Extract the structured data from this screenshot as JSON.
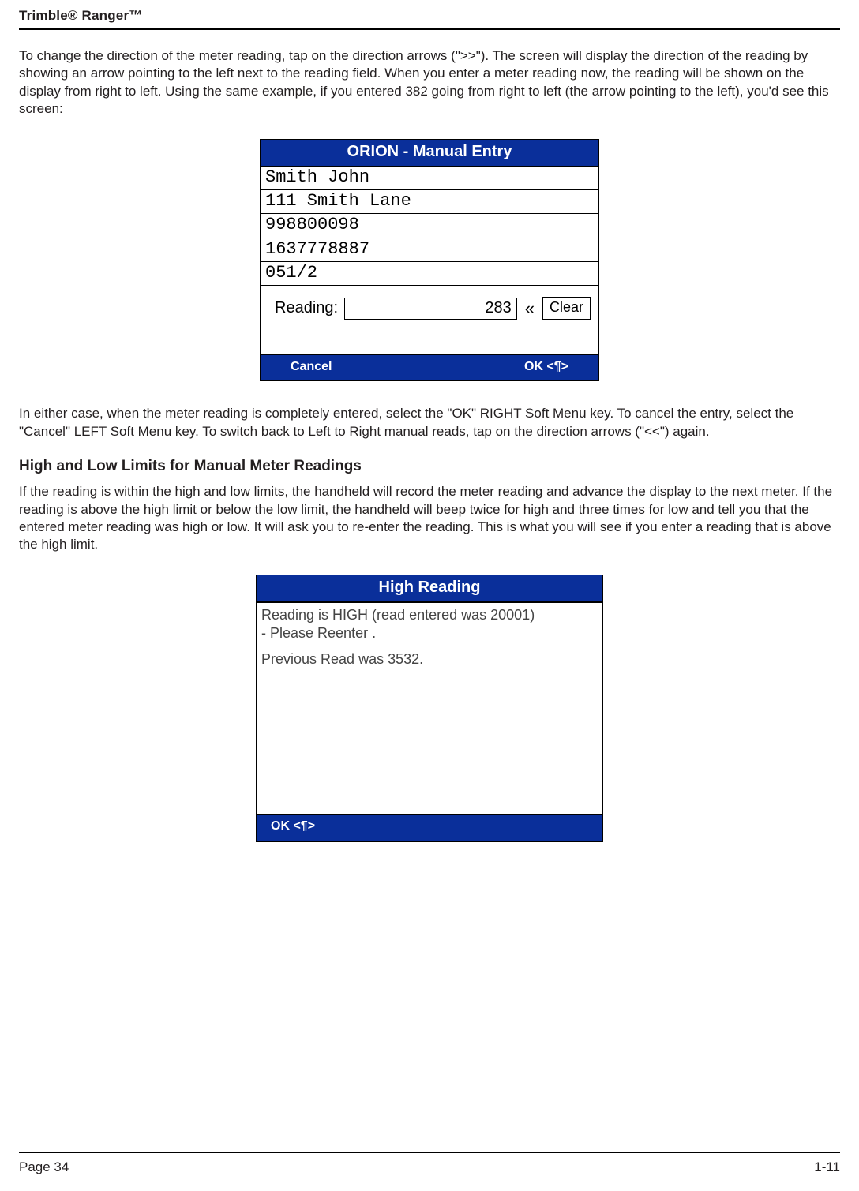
{
  "header": {
    "product": "Trimble® Ranger™"
  },
  "para1": "To change the direction of the meter reading, tap on the direction arrows (\">>\").  The screen will display the direction of the reading by showing an arrow pointing to the left next to the reading field.  When you enter a meter reading now, the reading will be shown on the display from right to left.  Using the same example, if you entered 382 going from right to left (the arrow pointing to the left), you'd see this screen:",
  "device1": {
    "title": "ORION - Manual Entry",
    "rows": [
      "Smith John",
      "111 Smith Lane",
      "998800098",
      "1637778887",
      "051/2"
    ],
    "reading_label": "Reading:",
    "reading_value": "283",
    "arrow_glyph": "«",
    "clear_prefix": "Cl",
    "clear_underlined": "e",
    "clear_suffix": "ar",
    "soft_left": "Cancel",
    "soft_right": "OK <¶>"
  },
  "para2": "In either case, when the meter reading is completely entered, select the \"OK\" RIGHT Soft Menu key. To cancel the entry, select the \"Cancel\" LEFT Soft Menu key.  To switch back to Left to Right manual reads, tap on the direction arrows (\"<<\") again.",
  "section_heading": "High and Low Limits for Manual Meter Readings",
  "para3": "If the reading is within the high and low limits, the handheld will record the meter reading and advance the display to the next meter.  If the reading is above the high limit or below the low limit, the handheld will beep twice for high and three times for low and tell you that the entered meter reading was high or low.  It will ask you to re-enter the reading.  This is what you will see if you enter a reading that is above the high limit.",
  "device2": {
    "title": "High Reading",
    "line1": "Reading is HIGH (read entered was 20001)",
    "line2": "- Please Reenter  .",
    "line3": "Previous Read was 3532.",
    "soft_left": "OK <¶>"
  },
  "footer": {
    "left": "Page 34",
    "right": "1-11"
  }
}
